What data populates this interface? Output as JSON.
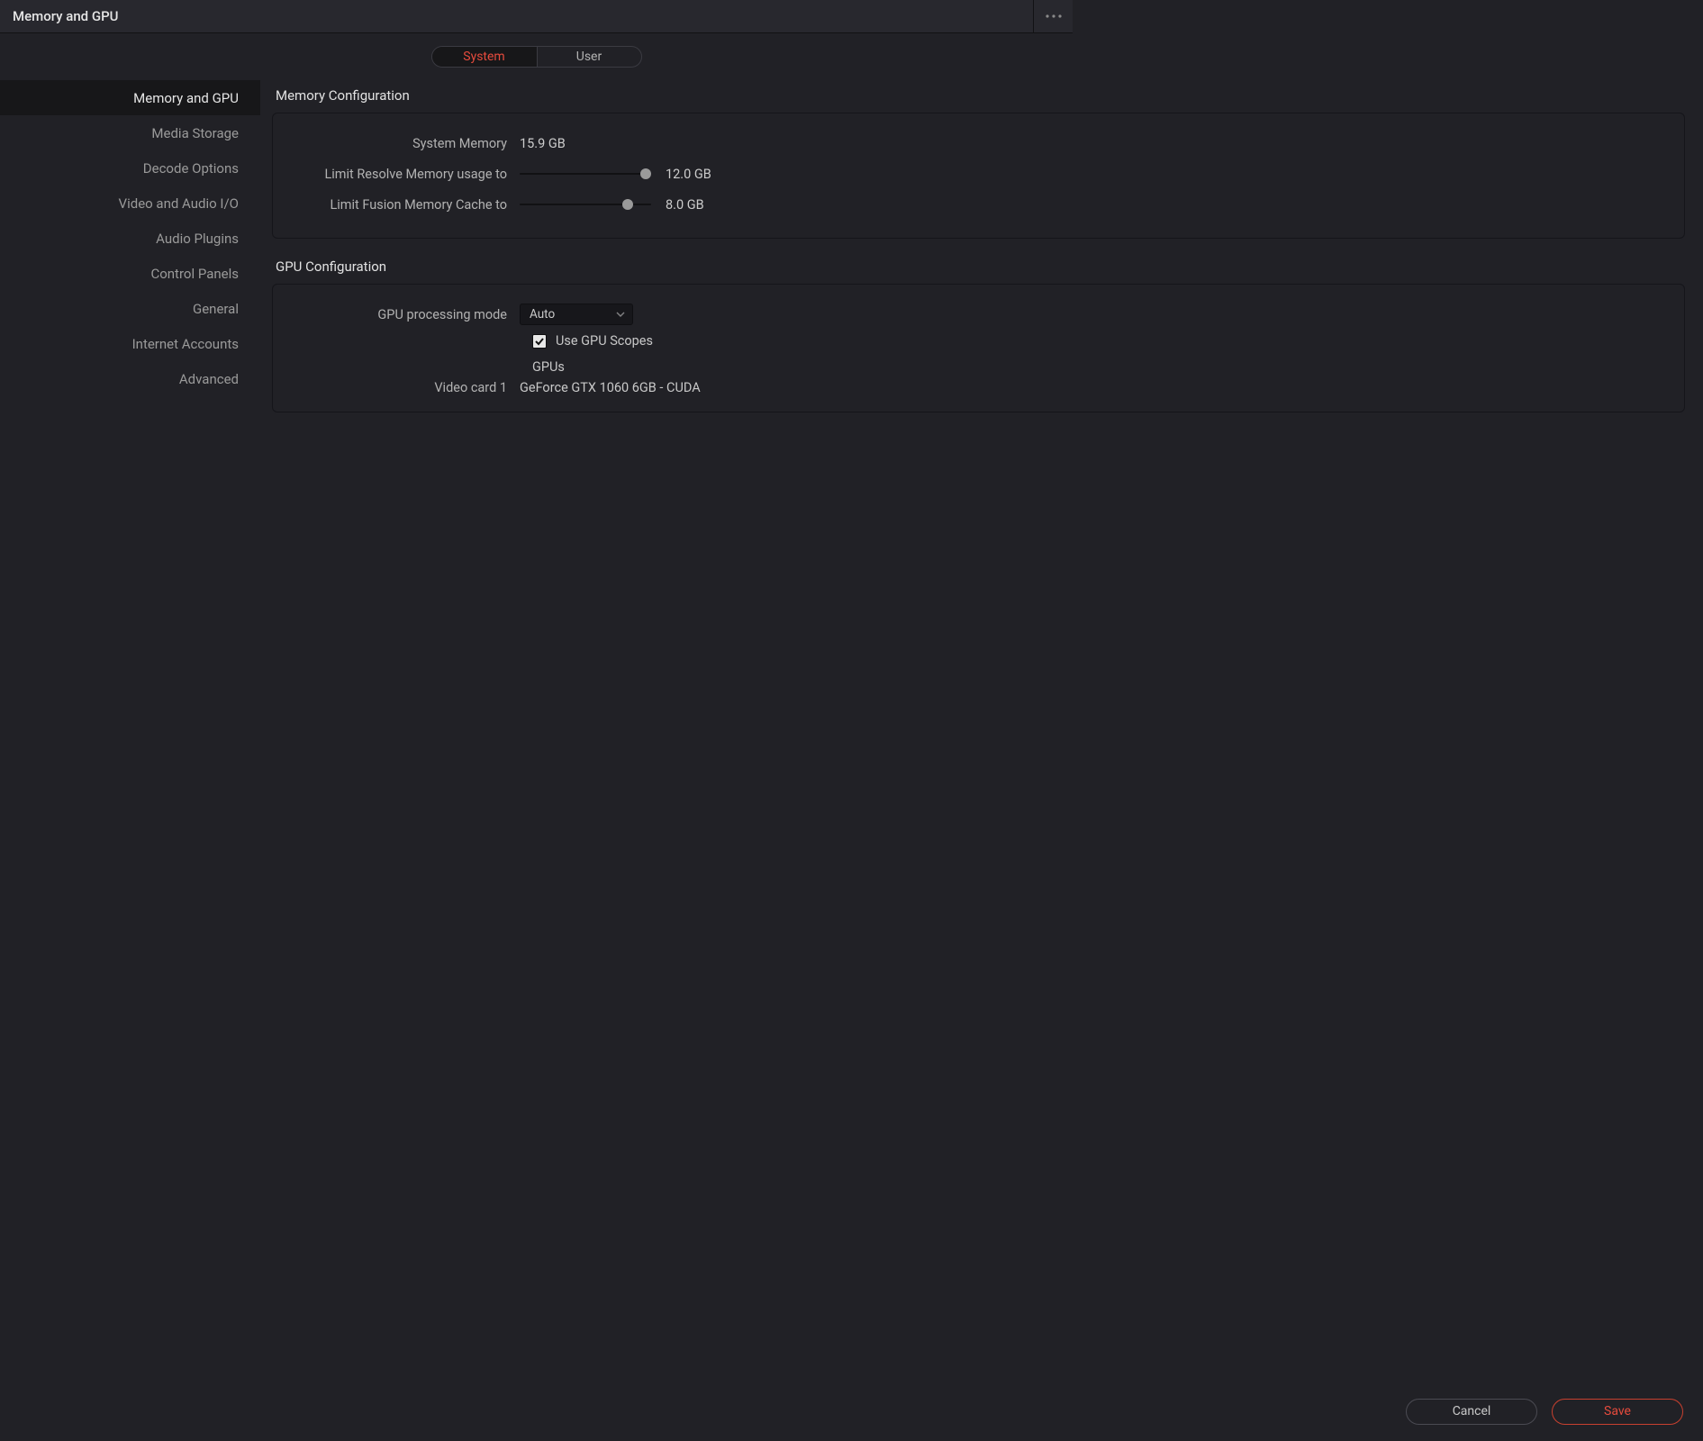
{
  "title": "Memory and GPU",
  "tabs": {
    "system": "System",
    "user": "User",
    "active": "system"
  },
  "sidebar": {
    "items": [
      {
        "label": "Memory and GPU",
        "active": true
      },
      {
        "label": "Media Storage"
      },
      {
        "label": "Decode Options"
      },
      {
        "label": "Video and Audio I/O"
      },
      {
        "label": "Audio Plugins"
      },
      {
        "label": "Control Panels"
      },
      {
        "label": "General"
      },
      {
        "label": "Internet Accounts"
      },
      {
        "label": "Advanced"
      }
    ]
  },
  "memory": {
    "section_title": "Memory Configuration",
    "system_memory_label": "System Memory",
    "system_memory_value": "15.9 GB",
    "resolve_limit_label": "Limit Resolve Memory usage to",
    "resolve_limit_value": "12.0 GB",
    "resolve_slider_pct": 96,
    "fusion_limit_label": "Limit Fusion Memory Cache to",
    "fusion_limit_value": "8.0 GB",
    "fusion_slider_pct": 82
  },
  "gpu": {
    "section_title": "GPU Configuration",
    "mode_label": "GPU processing mode",
    "mode_value": "Auto",
    "use_gpu_scopes_label": "Use GPU Scopes",
    "use_gpu_scopes_checked": true,
    "gpus_title": "GPUs",
    "video_card_label": "Video card 1",
    "video_card_value": "GeForce GTX 1060 6GB - CUDA"
  },
  "footer": {
    "cancel": "Cancel",
    "save": "Save"
  }
}
